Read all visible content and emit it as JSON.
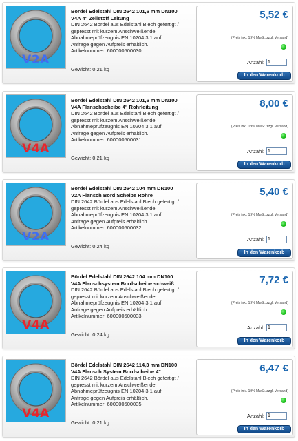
{
  "shared": {
    "vat_note": "(Preis inkl. 19% MwSt. zzgl. Versand)",
    "qty_label": "Anzahl:",
    "cart_label": "In den Warenkorb",
    "availability_color": "#1fc41f",
    "accent_color": "#1a66b0"
  },
  "products": [
    {
      "grade": "V2A",
      "title_1": "Bördel Edelstahl DIN 2642 101,6 mm DN100",
      "title_2": "V4A 4\" Zellstoff Leitung",
      "desc_1": "DIN 2642 Bördel aus Edelstahl Blech gefertigt /",
      "desc_2": "gepresst mit kurzem Anschweißende",
      "desc_3": "Abnahmeprüfzeugnis EN 10204 3.1 auf",
      "desc_4": "Anfrage gegen Aufpreis erhältlich.",
      "article": "Artikelnummer: 600000500030",
      "weight": "Gewicht: 0,21 kg",
      "price": "5,52 €",
      "qty": "1"
    },
    {
      "grade": "V4A",
      "title_1": "Bördel Edelstahl DIN 2642 101,6 mm DN100",
      "title_2": "V4A Flanschscheibe 4\" Rohrleitung",
      "desc_1": "DIN 2642 Bördel aus Edelstahl Blech gefertigt /",
      "desc_2": "gepresst mit kurzem Anschweißende",
      "desc_3": "Abnahmeprüfzeugnis EN 10204 3.1 auf",
      "desc_4": "Anfrage gegen Aufpreis erhältlich.",
      "article": "Artikelnummer: 600000500031",
      "weight": "Gewicht: 0,21 kg",
      "price": "8,00 €",
      "qty": "1"
    },
    {
      "grade": "V2A",
      "title_1": "Bördel Edelstahl DIN 2642 104 mm DN100",
      "title_2": "V2A Flansch Bord Scheibe Rohre",
      "desc_1": "DIN 2642 Bördel aus Edelstahl Blech gefertigt /",
      "desc_2": "gepresst mit kurzem Anschweißende",
      "desc_3": "Abnahmeprüfzeugnis EN 10204 3.1 auf",
      "desc_4": "Anfrage gegen Aufpreis erhältlich.",
      "article": "Artikelnummer: 600000500032",
      "weight": "Gewicht: 0,24 kg",
      "price": "5,40 €",
      "qty": "1"
    },
    {
      "grade": "V4A",
      "title_1": "Bördel Edelstahl DIN 2642 104 mm DN100",
      "title_2": "V4A Flanschsystem Bordscheibe schweiß",
      "desc_1": "DIN 2642 Bördel aus Edelstahl Blech gefertigt /",
      "desc_2": "gepresst mit kurzem Anschweißende",
      "desc_3": "Abnahmeprüfzeugnis EN 10204 3.1 auf",
      "desc_4": "Anfrage gegen Aufpreis erhältlich.",
      "article": "Artikelnummer: 600000500033",
      "weight": "Gewicht: 0,24 kg",
      "price": "7,72 €",
      "qty": "1"
    },
    {
      "grade": "V4A",
      "title_1": "Bördel Edelstahl DIN 2642 114,3 mm DN100",
      "title_2": "V4A Flansch System Bordscheibe 4\"",
      "desc_1": "DIN 2642 Bördel aus Edelstahl Blech gefertigt /",
      "desc_2": "gepresst mit kurzem Anschweißende",
      "desc_3": "Abnahmeprüfzeugnis EN 10204 3.1 auf",
      "desc_4": "Anfrage gegen Aufpreis erhältlich.",
      "article": "Artikelnummer: 600000500035",
      "weight": "Gewicht: 0,21 kg",
      "price": "6,47 €",
      "qty": "1"
    }
  ]
}
